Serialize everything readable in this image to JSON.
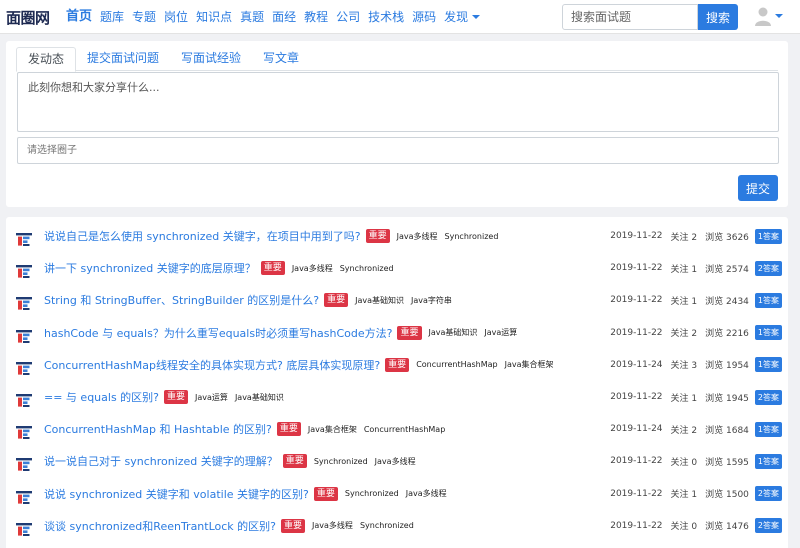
{
  "nav": {
    "brand": "面圈网",
    "links": [
      "首页",
      "题库",
      "专题",
      "岗位",
      "知识点",
      "真题",
      "面经",
      "教程",
      "公司",
      "技术栈",
      "源码",
      "发现"
    ],
    "search_placeholder": "搜索面试题",
    "search_button": "搜索"
  },
  "post": {
    "tabs": [
      "发动态",
      "提交面试问题",
      "写面试经验",
      "写文章"
    ],
    "text_placeholder": "此刻你想和大家分享什么...",
    "circle_placeholder": "请选择圈子",
    "submit_label": "提交"
  },
  "questions": [
    {
      "title": "说说自己是怎么使用 synchronized 关键字，在项目中用到了吗?",
      "badge": "重要",
      "tags": [
        "Java多线程",
        "Synchronized"
      ],
      "date": "2019-11-22",
      "follows": "关注 2",
      "views": "浏览 3626",
      "answers": "1答案"
    },
    {
      "title": "讲一下 synchronized 关键字的底层原理？",
      "badge": "重要",
      "tags": [
        "Java多线程",
        "Synchronized"
      ],
      "date": "2019-11-22",
      "follows": "关注 1",
      "views": "浏览 2574",
      "answers": "2答案"
    },
    {
      "title": "String 和 StringBuffer、StringBuilder 的区别是什么?",
      "badge": "重要",
      "tags": [
        "Java基础知识",
        "Java字符串"
      ],
      "date": "2019-11-22",
      "follows": "关注 1",
      "views": "浏览 2434",
      "answers": "1答案"
    },
    {
      "title": "hashCode 与 equals？为什么重写equals时必须重写hashCode方法?",
      "badge": "重要",
      "tags": [
        "Java基础知识",
        "Java运算"
      ],
      "date": "2019-11-22",
      "follows": "关注 2",
      "views": "浏览 2216",
      "answers": "1答案"
    },
    {
      "title": "ConcurrentHashMap线程安全的具体实现方式? 底层具体实现原理?",
      "badge": "重要",
      "tags": [
        "ConcurrentHashMap",
        "Java集合框架"
      ],
      "date": "2019-11-24",
      "follows": "关注 3",
      "views": "浏览 1954",
      "answers": "1答案"
    },
    {
      "title": "== 与 equals 的区别?",
      "badge": "重要",
      "tags": [
        "Java运算",
        "Java基础知识"
      ],
      "date": "2019-11-22",
      "follows": "关注 1",
      "views": "浏览 1945",
      "answers": "2答案"
    },
    {
      "title": "ConcurrentHashMap 和 Hashtable 的区别?",
      "badge": "重要",
      "tags": [
        "Java集合框架",
        "ConcurrentHashMap"
      ],
      "date": "2019-11-24",
      "follows": "关注 2",
      "views": "浏览 1684",
      "answers": "1答案"
    },
    {
      "title": "说一说自己对于 synchronized 关键字的理解？",
      "badge": "重要",
      "tags": [
        "Synchronized",
        "Java多线程"
      ],
      "date": "2019-11-22",
      "follows": "关注 0",
      "views": "浏览 1595",
      "answers": "1答案"
    },
    {
      "title": "说说 synchronized 关键字和 volatile 关键字的区别?",
      "badge": "重要",
      "tags": [
        "Synchronized",
        "Java多线程"
      ],
      "date": "2019-11-22",
      "follows": "关注 1",
      "views": "浏览 1500",
      "answers": "2答案"
    },
    {
      "title": "谈谈 synchronized和ReenTrantLock 的区别?",
      "badge": "重要",
      "tags": [
        "Java多线程",
        "Synchronized"
      ],
      "date": "2019-11-22",
      "follows": "关注 0",
      "views": "浏览 1476",
      "answers": "2答案"
    }
  ]
}
